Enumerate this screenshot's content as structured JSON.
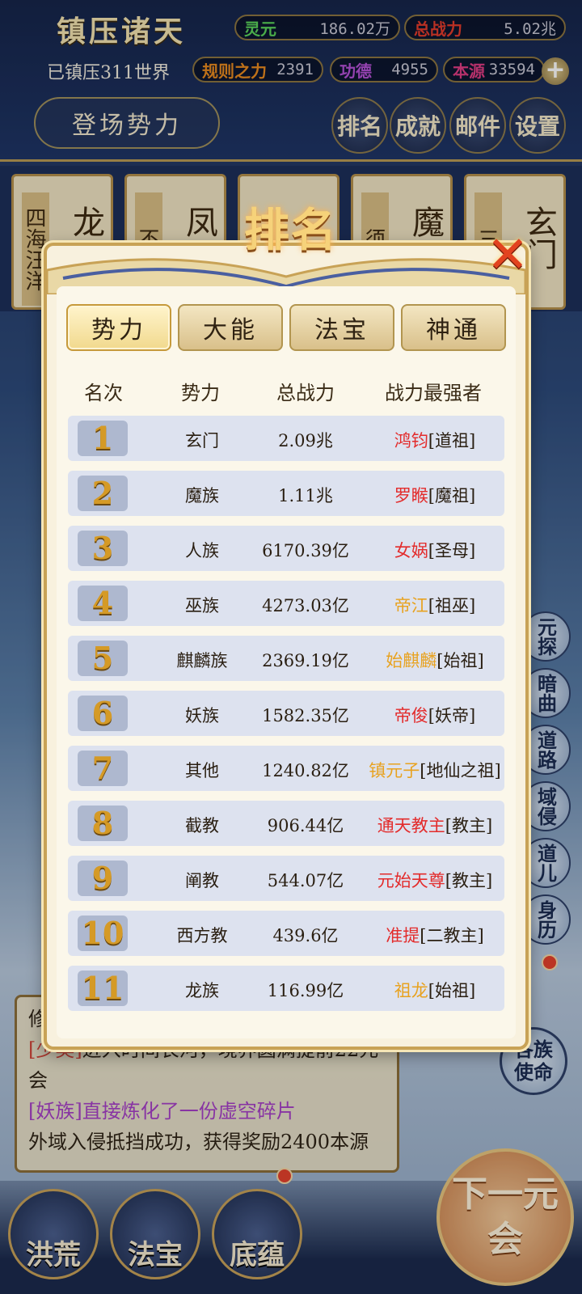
{
  "header": {
    "game_title": "镇压诸天",
    "suppressed_text": "已镇压311世界",
    "enter_button": "登场势力",
    "resources": [
      {
        "label": "灵元",
        "value": "186.02万",
        "label_color": "#5bd35b"
      },
      {
        "label": "总战力",
        "value": "5.02兆",
        "label_color": "#e23b2b"
      },
      {
        "label": "规则之力",
        "value": "2391",
        "label_color": "#e88a1f"
      },
      {
        "label": "功德",
        "value": "4955",
        "label_color": "#b451d6"
      },
      {
        "label": "本源",
        "value": "33594",
        "label_color": "#e03c83"
      }
    ],
    "plus_icon": "+",
    "top_icons": [
      {
        "label": "排名",
        "icon": "ranking-icon"
      },
      {
        "label": "成就",
        "icon": "achievement-icon"
      },
      {
        "label": "邮件",
        "icon": "mail-icon"
      },
      {
        "label": "设置",
        "icon": "settings-icon"
      }
    ]
  },
  "background_cards": [
    {
      "side": "四海汪洋",
      "main": "龙"
    },
    {
      "side": "不灭",
      "main": "凤"
    },
    {
      "side": "",
      "main": ""
    },
    {
      "side": "须弥",
      "main": "魔"
    },
    {
      "side": "三十",
      "main": "玄门"
    }
  ],
  "side_tabs": [
    "元探",
    "暗曲",
    "道路",
    "域侵",
    "道儿",
    "身历"
  ],
  "log": {
    "title": "修",
    "lines": [
      {
        "tag": "[少昊]",
        "tag_color": "#d2453a",
        "text": "进入时间长河，境界圆满提前22元会"
      },
      {
        "tag": "[妖族]直接炼化了一份虚空碎片",
        "tag_color": "#a640c7",
        "text": ""
      },
      {
        "tag": "",
        "tag_color": "",
        "text": "外域入侵抵挡成功，获得奖励2400本源"
      }
    ]
  },
  "clan_button": "各族使命",
  "bottom_nav": [
    "洪荒",
    "法宝",
    "底蕴"
  ],
  "next_button": "下一元会",
  "modal": {
    "title": "排名",
    "close_icon": "✕",
    "tabs": [
      "势力",
      "大能",
      "法宝",
      "神通"
    ],
    "active_tab": 0,
    "columns": [
      "名次",
      "势力",
      "总战力",
      "战力最强者"
    ],
    "rows": [
      {
        "rank": "1",
        "faction": "玄门",
        "power": "2.09兆",
        "hero": "鸿钧",
        "title": "[道祖]",
        "hero_color": "#e32b2b"
      },
      {
        "rank": "2",
        "faction": "魔族",
        "power": "1.11兆",
        "hero": "罗睺",
        "title": "[魔祖]",
        "hero_color": "#e32b2b"
      },
      {
        "rank": "3",
        "faction": "人族",
        "power": "6170.39亿",
        "hero": "女娲",
        "title": "[圣母]",
        "hero_color": "#e32b2b"
      },
      {
        "rank": "4",
        "faction": "巫族",
        "power": "4273.03亿",
        "hero": "帝江",
        "title": "[祖巫]",
        "hero_color": "#e8a21f"
      },
      {
        "rank": "5",
        "faction": "麒麟族",
        "power": "2369.19亿",
        "hero": "始麒麟",
        "title": "[始祖]",
        "hero_color": "#e8a21f"
      },
      {
        "rank": "6",
        "faction": "妖族",
        "power": "1582.35亿",
        "hero": "帝俊",
        "title": "[妖帝]",
        "hero_color": "#e32b2b"
      },
      {
        "rank": "7",
        "faction": "其他",
        "power": "1240.82亿",
        "hero": "镇元子",
        "title": "[地仙之祖]",
        "hero_color": "#e8a21f"
      },
      {
        "rank": "8",
        "faction": "截教",
        "power": "906.44亿",
        "hero": "通天教主",
        "title": "[教主]",
        "hero_color": "#e32b2b"
      },
      {
        "rank": "9",
        "faction": "阐教",
        "power": "544.07亿",
        "hero": "元始天尊",
        "title": "[教主]",
        "hero_color": "#e32b2b"
      },
      {
        "rank": "10",
        "faction": "西方教",
        "power": "439.6亿",
        "hero": "准提",
        "title": "[二教主]",
        "hero_color": "#e32b2b"
      },
      {
        "rank": "11",
        "faction": "龙族",
        "power": "116.99亿",
        "hero": "祖龙",
        "title": "[始祖]",
        "hero_color": "#e8a21f"
      }
    ]
  }
}
